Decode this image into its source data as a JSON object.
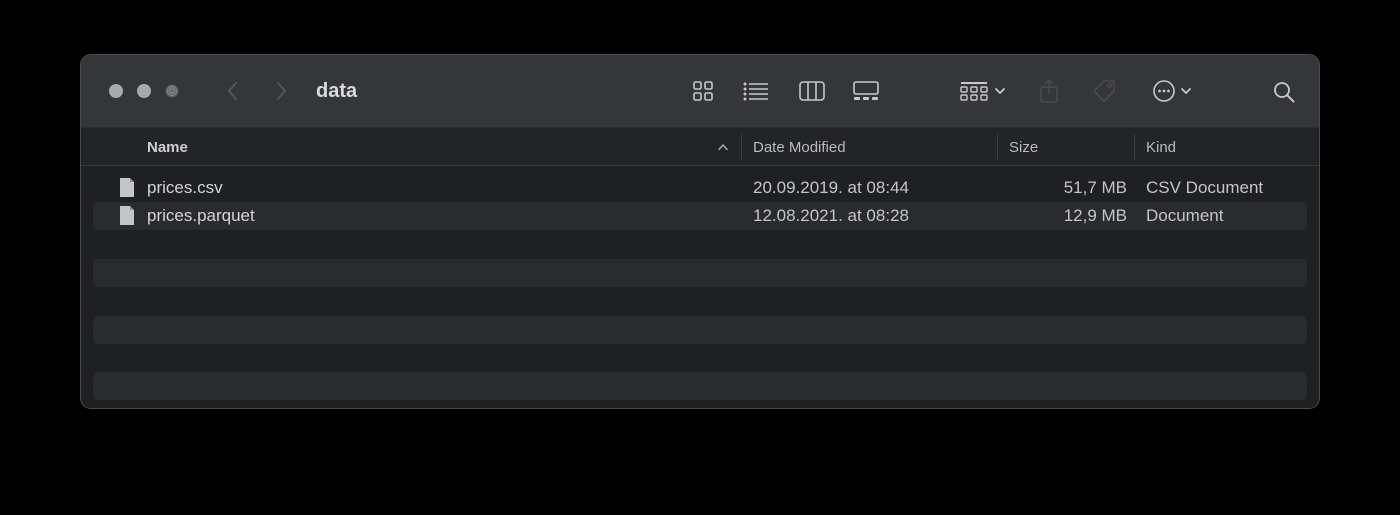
{
  "window": {
    "title": "data"
  },
  "toolbar": {
    "icons": [
      "back-icon",
      "forward-icon",
      "icon-view-icon",
      "list-view-icon",
      "column-view-icon",
      "gallery-view-icon",
      "group-icon",
      "share-icon",
      "tag-icon",
      "more-icon",
      "search-icon"
    ]
  },
  "columns": {
    "name": "Name",
    "date": "Date Modified",
    "size": "Size",
    "kind": "Kind"
  },
  "files": [
    {
      "name": "prices.csv",
      "date": "20.09.2019. at 08:44",
      "size": "51,7 MB",
      "kind": "CSV Document"
    },
    {
      "name": "prices.parquet",
      "date": "12.08.2021. at 08:28",
      "size": "12,9 MB",
      "kind": "Document"
    }
  ],
  "colors": {
    "background": "#000000",
    "window": "#1f2022",
    "titlebar": "#353639",
    "row_stripe": "#2a2b2e",
    "text": "#d4d5d8"
  }
}
